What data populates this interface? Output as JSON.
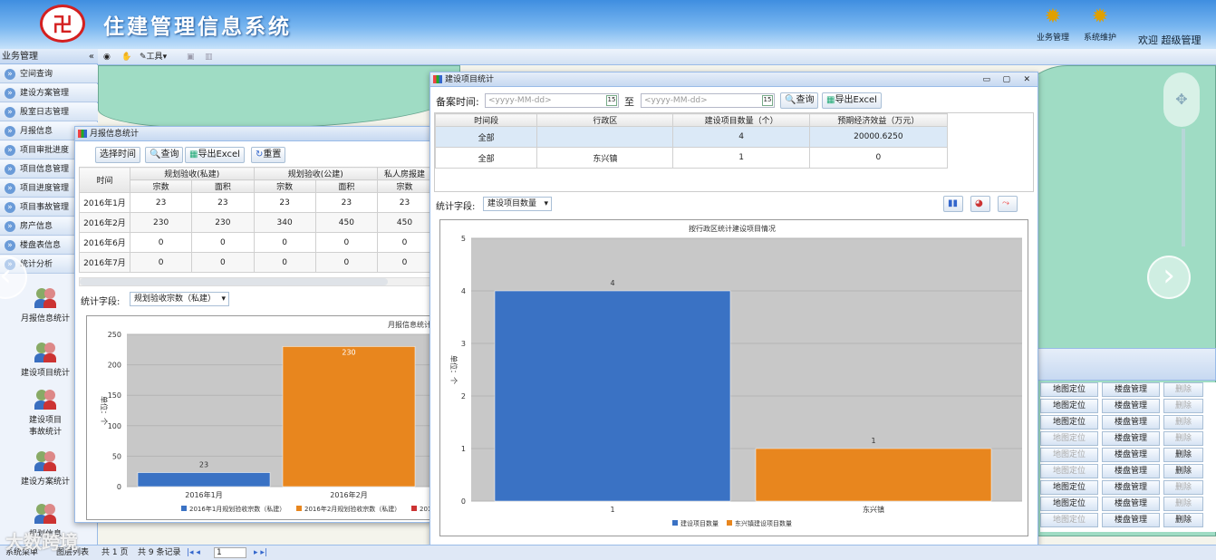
{
  "app": {
    "title": "住建管理信息系统",
    "welcome": "欢迎 超级管理",
    "top_buttons": [
      {
        "label": "业务管理",
        "icon": "gear-icon"
      },
      {
        "label": "系统维护",
        "icon": "gear-icon"
      }
    ]
  },
  "sidebar": {
    "header": "业务管理",
    "items": [
      "空间查询",
      "建设方案管理",
      "股室日志管理",
      "月报信息",
      "项目审批进度",
      "项目信息管理",
      "项目进度管理",
      "项目事故管理",
      "房产信息",
      "楼盘表信息",
      "统计分析"
    ],
    "subitems": [
      "月报信息统计",
      "建设项目统计",
      "建设项目\n事故统计",
      "建设方案统计",
      "规划信息"
    ]
  },
  "map_toolbar": {
    "tools_label": "工具"
  },
  "monthly": {
    "title": "月报信息统计",
    "buttons": [
      "选择时间",
      "查询",
      "导出Excel",
      "重置"
    ],
    "group_headers": [
      "规划验收(私建)",
      "规划验收(公建)",
      "私人房报建"
    ],
    "col_headers": [
      "时间",
      "宗数",
      "面积",
      "宗数",
      "面积",
      "宗数"
    ],
    "rows": [
      [
        "2016年1月",
        "23",
        "23",
        "23",
        "23",
        "23"
      ],
      [
        "2016年2月",
        "230",
        "230",
        "340",
        "450",
        "450"
      ],
      [
        "2016年6月",
        "0",
        "0",
        "0",
        "0",
        "0"
      ],
      [
        "2016年7月",
        "0",
        "0",
        "0",
        "0",
        "0"
      ]
    ],
    "field_label": "统计字段:",
    "field_value": "规划验收宗数（私建）"
  },
  "project": {
    "title": "建设项目统计",
    "date_label": "备案时间:",
    "to_label": "至",
    "date_placeholder": "<yyyy-MM-dd>",
    "query": "查询",
    "export": "导出Excel",
    "headers": [
      "时间段",
      "行政区",
      "建设项目数量（个）",
      "预期经济效益（万元）"
    ],
    "rows": [
      [
        "全部",
        "",
        "4",
        "20000.6250"
      ],
      [
        "全部",
        "东兴镇",
        "1",
        "0"
      ]
    ],
    "field_label": "统计字段:",
    "field_value": "建设项目数量"
  },
  "actions": {
    "locate": "地图定位",
    "building": "楼盘管理",
    "delete": "删除"
  },
  "status": {
    "left": "系统菜单",
    "mid": "图层列表",
    "pages": "共 1 页",
    "records": "共 9 条记录",
    "page": "1"
  },
  "watermark": "大数跨境",
  "chart_data": [
    {
      "type": "bar",
      "title": "月报信息统计情",
      "categories": [
        "2016年1月",
        "2016年2月"
      ],
      "values": [
        23,
        230
      ],
      "ylabel": "单位：个",
      "ylim": [
        0,
        250
      ],
      "yticks": [
        0,
        50,
        100,
        150,
        200,
        250
      ],
      "legend": [
        "2016年1月规划验收宗数（私建）",
        "2016年2月规划验收宗数（私建）",
        "201"
      ],
      "colors": [
        "#3a72c4",
        "#e8861e"
      ]
    },
    {
      "type": "bar",
      "title": "按行政区统计建设项目情况",
      "categories": [
        "1",
        "东兴镇"
      ],
      "values": [
        4,
        1
      ],
      "ylabel": "单位：个",
      "ylim": [
        0,
        5
      ],
      "yticks": [
        0,
        1,
        2,
        3,
        4,
        5
      ],
      "legend": [
        "建设项目数量",
        "东兴镇建设项目数量"
      ],
      "colors": [
        "#3a72c4",
        "#e8861e"
      ]
    }
  ]
}
